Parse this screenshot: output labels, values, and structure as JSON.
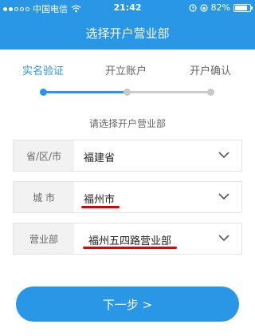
{
  "status_bar": {
    "carrier": "中国电信",
    "time": "21:42",
    "battery": "82%",
    "battery_level": 0.82
  },
  "header": {
    "title": "选择开户营业部"
  },
  "steps": [
    {
      "label": "实名验证",
      "active": true
    },
    {
      "label": "开立账户",
      "active": false
    },
    {
      "label": "开户确认",
      "active": false
    }
  ],
  "colors": {
    "primary": "#2a96e6",
    "highlight": "#e10000"
  },
  "form": {
    "title": "请选择开户营业部",
    "province": {
      "label": "省/区/市",
      "value": "福建省"
    },
    "city": {
      "label": "城 市",
      "value": "福州市"
    },
    "branch": {
      "label": "营业部",
      "value": "福州五四路营业部"
    }
  },
  "next_button": {
    "label": "下一步 >"
  }
}
